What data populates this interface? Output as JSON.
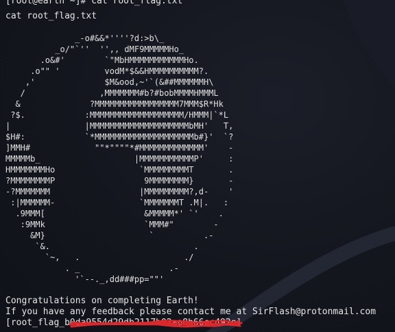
{
  "terminal": {
    "prompt_line": "[root@earth ~]# cat root_flag.txt",
    "command_echo": "cat root_flag.txt",
    "ascii_art": "              _-o#&&*''''?d:>b\\_\n          _o/\"`''  '',, dMF9MMMMMHo_\n       .o&#'        `\"MbHMMMMMMMMMMMHo.\n     .o\"\" '         vodM*$&&HMMMMMMMMMM?.\n    ,'              $M&ood,~'`(&##MMMMMMH\\\n   /               ,MMMMMMM#b?#bobMMMMHMMML\n  &              ?MMMMMMMMMMMMMMMMM7MMM$R*Hk\n ?$.            :MMMMMMMMMMMMMMMMMMM/HMMM|`*L\n|               |MMMMMMMMMMMMMMMMMMMMbMH'   T,\n$H#:            `*MMMMMMMMMMMMMMMMMMMMb#}'  `?\n]MMH#             \"\"*\"\"\"\"*#MMMMMMMMMMMMM'    -\nMMMMMb_                   |MMMMMMMMMMMP'     :\nHMMMMMMMHo                 `MMMMMMMMMT       .\n?MMMMMMMMP                  9MMMMMMMM}       -\n-?MMMMMMM                  |MMMMMMMMM?,d-    '\n :|MMMMMM-                 `MMMMMMMT .M|.   :\n  .9MMM[                    &MMMMM*' `'    .\n   :9MMk                    `MMM#\"        -\n     &M}                     `          .-\n      `&.                             .\n        `~,   .                     ./\n            . _                  .-\n              '`--._,dd###pp=\"\"'",
    "congrats": "Congratulations on completing Earth!",
    "feedback": "If you have any feedback please contact me at SirFlash@protonmail.com",
    "flag_line": "[root_flag_b0da9554d29db2117b02aa8b66ec492e]"
  },
  "colors": {
    "background": "#14161e",
    "text": "#e6e6e6",
    "redaction": "#e0262a"
  }
}
